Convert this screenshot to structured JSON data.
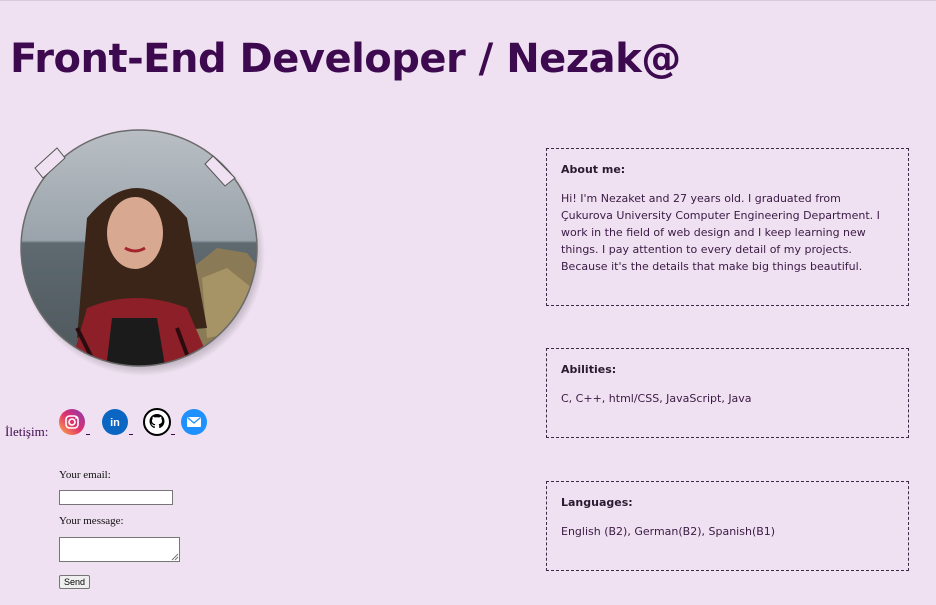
{
  "header": {
    "title": "Front-End Developer / Nezak@"
  },
  "contact": {
    "label": "İletişim:",
    "links": [
      {
        "icon": "instagram-icon",
        "color": "#e1306c"
      },
      {
        "icon": "linkedin-icon",
        "color": "#0a66c2"
      },
      {
        "icon": "github-icon",
        "color": "#000000"
      },
      {
        "icon": "email-icon",
        "color": "#1e90ff"
      }
    ]
  },
  "form": {
    "email_label": "Your email:",
    "email_value": "",
    "message_label": "Your message:",
    "message_value": "",
    "send_label": "Send"
  },
  "about": {
    "heading": "About me:",
    "text": "Hi! I'm Nezaket and 27 years old. I graduated from Çukurova University Computer Engineering Department. I work in the field of web design and I keep learning new things. I pay attention to every detail of my projects. Because it's the details that make big things beautiful."
  },
  "abilities": {
    "heading": "Abilities:",
    "text": "C, C++, html/CSS, JavaScript, Java"
  },
  "languages": {
    "heading": "Languages:",
    "text": "English (B2), German(B2), Spanish(B1)"
  },
  "colors": {
    "background": "#efe1f1",
    "title": "#3d0a4f",
    "text": "#3a1a44"
  }
}
